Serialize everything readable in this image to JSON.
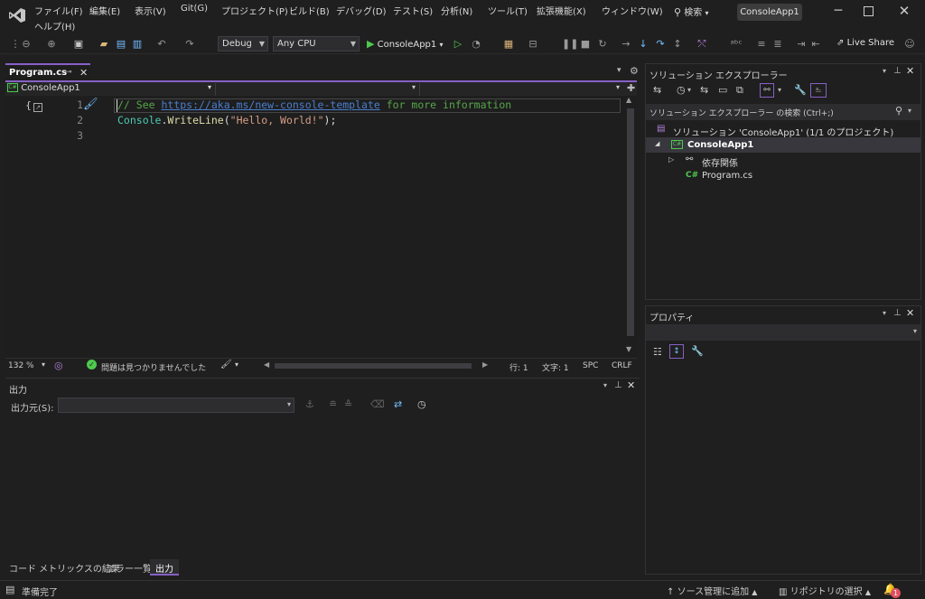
{
  "menu": {
    "items": [
      "ファイル(F)",
      "編集(E)",
      "表示(V)",
      "Git(G)",
      "プロジェクト(P)",
      "ビルド(B)",
      "デバッグ(D)",
      "テスト(S)",
      "分析(N)",
      "ツール(T)",
      "拡張機能(X)",
      "ウィンドウ(W)"
    ],
    "help": "ヘルプ(H)",
    "search_label": "検索",
    "solution_badge": "ConsoleApp1"
  },
  "toolbar": {
    "config": "Debug",
    "platform": "Any CPU",
    "run_target": "ConsoleApp1",
    "live_share": "Live Share"
  },
  "editor": {
    "tab_label": "Program.cs",
    "project_dropdown": "ConsoleApp1",
    "lines": [
      {
        "number": "1",
        "comment_prefix": "// See ",
        "link": "https://aka.ms/new-console-template",
        "comment_suffix": " for more information"
      },
      {
        "number": "2",
        "code_class": "Console",
        "code_dot": ".",
        "code_method": "WriteLine",
        "code_open": "(",
        "code_string": "\"Hello, World!\"",
        "code_close": ");"
      },
      {
        "number": "3"
      }
    ],
    "zoom": "132 %",
    "issues": "問題は見つかりませんでした",
    "line_pos": "行: 1",
    "char_pos": "文字: 1",
    "spc": "SPC",
    "crlf": "CRLF"
  },
  "output": {
    "title": "出力",
    "source_label": "出力元(S):"
  },
  "bottom_tabs": [
    "コード メトリックスの結果",
    "エラー一覧",
    "出力"
  ],
  "solution_explorer": {
    "title": "ソリューション エクスプローラー",
    "search_placeholder": "ソリューション エクスプローラー の検索 (Ctrl+;)",
    "solution": "ソリューション 'ConsoleApp1' (1/1 のプロジェクト)",
    "project": "ConsoleApp1",
    "dependencies": "依存関係",
    "file": "Program.cs"
  },
  "properties": {
    "title": "プロパティ"
  },
  "status": {
    "ready": "準備完了",
    "add_source": "ソース管理に追加",
    "select_repo": "リポジトリの選択",
    "notification_count": "1"
  },
  "colors": {
    "accent": "#8661c5",
    "comment": "#57a64a",
    "link": "#4a7ecf",
    "string": "#d69d85",
    "code": "#dcdcdc",
    "selected_tab": "#8661c5"
  }
}
